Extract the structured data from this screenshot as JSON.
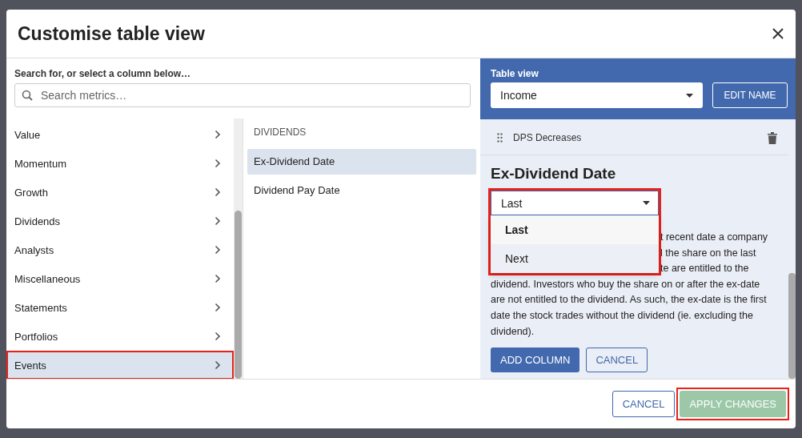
{
  "dialog": {
    "title": "Customise table view"
  },
  "search": {
    "label": "Search for, or select a column below…",
    "placeholder": "Search metrics…"
  },
  "categories": [
    {
      "label": "Value",
      "selected": false,
      "highlighted": false
    },
    {
      "label": "Momentum",
      "selected": false,
      "highlighted": false
    },
    {
      "label": "Growth",
      "selected": false,
      "highlighted": false
    },
    {
      "label": "Dividends",
      "selected": false,
      "highlighted": false
    },
    {
      "label": "Analysts",
      "selected": false,
      "highlighted": false
    },
    {
      "label": "Miscellaneous",
      "selected": false,
      "highlighted": false
    },
    {
      "label": "Statements",
      "selected": false,
      "highlighted": false
    },
    {
      "label": "Portfolios",
      "selected": false,
      "highlighted": false
    },
    {
      "label": "Events",
      "selected": true,
      "highlighted": true
    }
  ],
  "subcategory": {
    "heading": "DIVIDENDS",
    "items": [
      {
        "label": "Ex-Dividend Date",
        "selected": true
      },
      {
        "label": "Dividend Pay Date",
        "selected": false
      }
    ]
  },
  "table_view": {
    "label": "Table view",
    "value": "Income",
    "edit_button": "EDIT NAME"
  },
  "columns_list": [
    {
      "label": "DPS Decreases"
    }
  ],
  "metric": {
    "title": "Ex-Dividend Date",
    "select": {
      "value": "Last",
      "highlighted": true,
      "expanded": true,
      "options": [
        {
          "label": "Last",
          "selected": true
        },
        {
          "label": "Next",
          "selected": false
        }
      ]
    },
    "description_lines": [
      {
        "text": "t recent date a company",
        "covered": true
      },
      {
        "text": "l the share on the last",
        "covered": true
      },
      {
        "text": "te are entitled to the",
        "covered": true
      },
      {
        "text": "dividend. Investors who buy the share on or after the ex-date",
        "covered": false
      },
      {
        "text": "are not entitled to the dividend. As such, the ex-date is the first",
        "covered": false
      },
      {
        "text": "date the stock trades without the dividend (ie. excluding the",
        "covered": false
      },
      {
        "text": "dividend).",
        "covered": false
      }
    ],
    "add_button": "ADD COLUMN",
    "cancel_button": "CANCEL"
  },
  "footer": {
    "cancel_button": "CANCEL",
    "apply_button": {
      "label": "APPLY CHANGES",
      "disabled": true,
      "highlighted": true
    }
  }
}
